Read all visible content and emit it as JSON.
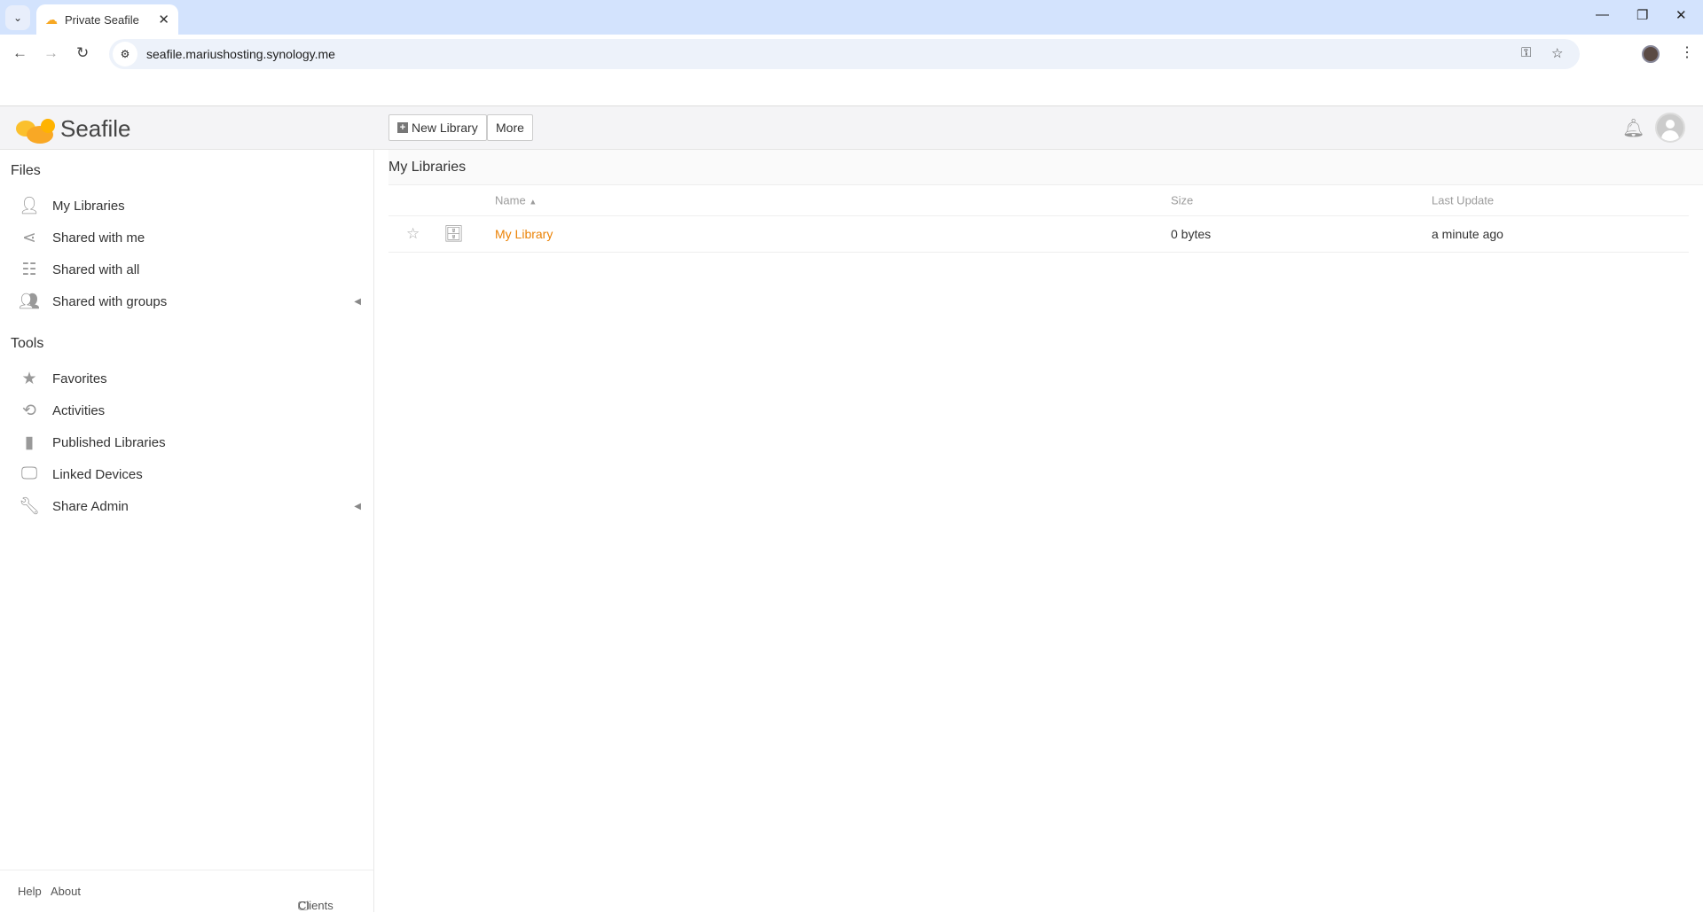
{
  "browser": {
    "tab_title": "Private Seafile",
    "url": "seafile.mariushosting.synology.me"
  },
  "header": {
    "logo_text": "Seafile",
    "new_library": "New Library",
    "more": "More"
  },
  "sidebar": {
    "files_heading": "Files",
    "files": [
      {
        "label": "My Libraries",
        "icon": "user-icon"
      },
      {
        "label": "Shared with me",
        "icon": "share-icon"
      },
      {
        "label": "Shared with all",
        "icon": "sitemap-icon"
      },
      {
        "label": "Shared with groups",
        "icon": "group-icon"
      }
    ],
    "tools_heading": "Tools",
    "tools": [
      {
        "label": "Favorites",
        "icon": "star-icon"
      },
      {
        "label": "Activities",
        "icon": "history-icon"
      },
      {
        "label": "Published Libraries",
        "icon": "book-icon"
      },
      {
        "label": "Linked Devices",
        "icon": "monitor-icon"
      },
      {
        "label": "Share Admin",
        "icon": "wrench-icon"
      }
    ],
    "footer": {
      "help": "Help",
      "about": "About",
      "clients": "Clients"
    }
  },
  "main": {
    "title": "My Libraries",
    "columns": {
      "name": "Name",
      "size": "Size",
      "last_update": "Last Update"
    },
    "rows": [
      {
        "name": "My Library",
        "size": "0 bytes",
        "last_update": "a minute ago"
      }
    ]
  },
  "colors": {
    "accent": "#eb8205",
    "logo": "#f9a825"
  }
}
